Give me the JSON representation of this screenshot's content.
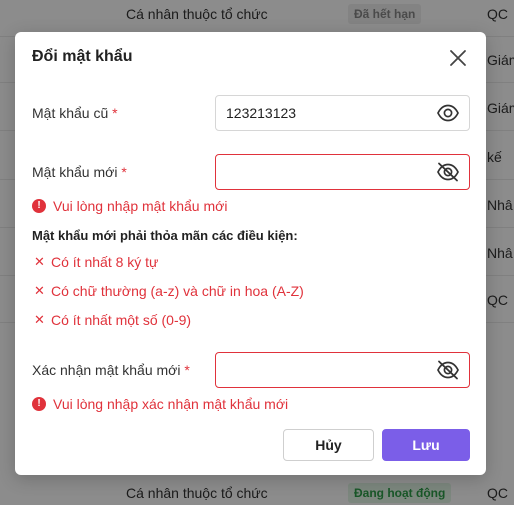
{
  "background": {
    "rows": [
      {
        "type": "Cá nhân thuộc tổ chức",
        "status": "Đã hết hạn",
        "status_kind": "expired",
        "role": "QC"
      },
      {
        "type": "",
        "status": "",
        "role": "Giám"
      },
      {
        "type": "",
        "status": "",
        "role": "Giám"
      },
      {
        "type": "",
        "status": "",
        "role": "kế"
      },
      {
        "type": "",
        "status": "",
        "role": "Nhâ"
      },
      {
        "type": "",
        "status": "",
        "role": "Nhâ"
      },
      {
        "type": "",
        "status": "",
        "role": "QC"
      },
      {
        "type": "",
        "status": "",
        "role": ""
      },
      {
        "type": "",
        "status": "",
        "role": ""
      },
      {
        "type": "",
        "status": "",
        "role": ""
      },
      {
        "type": "Cá nhân thuộc tổ chức",
        "status": "Đang hoạt động",
        "status_kind": "active",
        "role": "QC"
      }
    ]
  },
  "modal": {
    "title": "Đổi mật khẩu",
    "old_password": {
      "label": "Mật khẩu cũ",
      "required_mark": "*",
      "value": "123213123"
    },
    "new_password": {
      "label": "Mật khẩu mới",
      "required_mark": "*",
      "value": "",
      "error": "Vui lòng nhập mật khẩu mới"
    },
    "requirements": {
      "title": "Mật khẩu mới phải thỏa mãn các điều kiện:",
      "items": [
        "Có ít nhất 8 ký tự",
        "Có chữ thường (a-z) và chữ in hoa (A-Z)",
        "Có ít nhất một số (0-9)"
      ]
    },
    "confirm_password": {
      "label": "Xác nhận mật khẩu mới",
      "required_mark": "*",
      "value": "",
      "error": "Vui lòng nhập xác nhận mật khẩu mới"
    },
    "cancel_label": "Hủy",
    "save_label": "Lưu"
  },
  "colors": {
    "accent": "#7b5ee8",
    "error": "#e0323b"
  }
}
